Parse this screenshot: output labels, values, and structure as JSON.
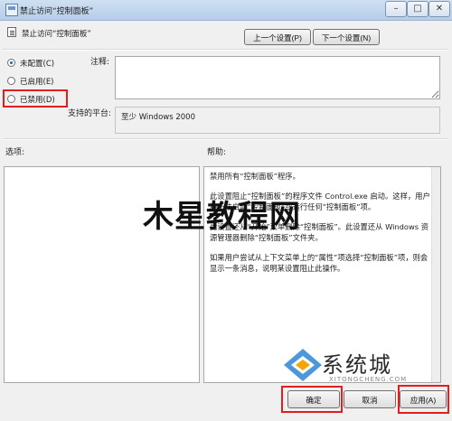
{
  "window": {
    "title": "禁止访问“控制面板”"
  },
  "setting": {
    "name": "禁止访问“控制面板”"
  },
  "nav": {
    "prev_label": "上一个设置(P)",
    "next_label": "下一个设置(N)"
  },
  "state": {
    "options": [
      {
        "label": "未配置(C)",
        "selected": true
      },
      {
        "label": "已启用(E)",
        "selected": false
      },
      {
        "label": "已禁用(D)",
        "selected": false
      }
    ]
  },
  "fields": {
    "notes_label": "注释:",
    "platform_label": "支持的平台:",
    "platform_value": "至少 Windows 2000"
  },
  "sections": {
    "options_label": "选项:",
    "help_label": "帮助:"
  },
  "help": {
    "paragraphs": [
      "禁用所有“控制面板”程序。",
      "此设置阻止“控制面板”的程序文件 Control.exe 启动。这样，用户将无法启动“控制面板”或运行任何“控制面板”项。",
      "此设置还从“开始”菜单删除“控制面板”。此设置还从 Windows 资源管理器删除“控制面板”文件夹。",
      "如果用户尝试从上下文菜单上的“属性”项选择“控制面板”项，则会显示一条消息，说明某设置阻止此操作。"
    ]
  },
  "footer": {
    "ok_label": "确定",
    "cancel_label": "取消",
    "apply_label": "应用(A)"
  },
  "watermark": {
    "main": "木星教程网",
    "brand": "系统城",
    "brand_sub": "XITONGCHENG.COM"
  },
  "colors": {
    "highlight": "#e02020",
    "titlebar": "#c4d7ee"
  },
  "icons": {
    "app": "policy-app-icon",
    "setting": "policy-setting-icon",
    "minimize": "minimize-icon",
    "maximize": "maximize-icon",
    "close": "close-icon"
  }
}
